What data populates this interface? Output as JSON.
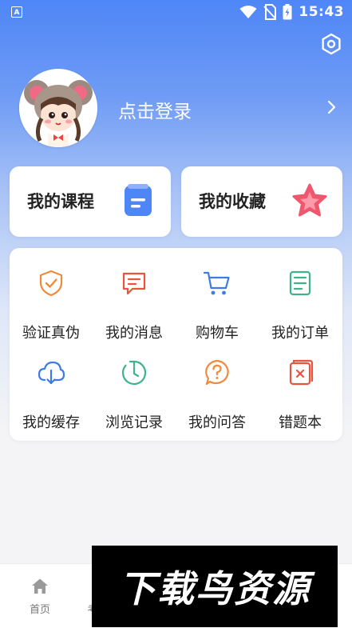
{
  "status_bar": {
    "time": "15:43",
    "app_icon_letter": "A"
  },
  "profile": {
    "login_label": "点击登录"
  },
  "cards": {
    "courses": {
      "label": "我的课程",
      "icon": "document-icon"
    },
    "favorites": {
      "label": "我的收藏",
      "icon": "star-icon"
    }
  },
  "grid": {
    "items": [
      {
        "label": "验证真伪",
        "icon": "shield-check-icon"
      },
      {
        "label": "我的消息",
        "icon": "message-icon"
      },
      {
        "label": "购物车",
        "icon": "cart-icon"
      },
      {
        "label": "我的订单",
        "icon": "order-icon"
      },
      {
        "label": "我的缓存",
        "icon": "cloud-download-icon"
      },
      {
        "label": "浏览记录",
        "icon": "history-icon"
      },
      {
        "label": "我的问答",
        "icon": "question-icon"
      },
      {
        "label": "错题本",
        "icon": "error-book-icon"
      }
    ]
  },
  "tabbar": {
    "home_label": "首页",
    "second_label": "考"
  },
  "watermark": {
    "text": "下载鸟资源"
  },
  "colors": {
    "primary": "#4f86f7",
    "orange": "#f08a3c",
    "red": "#e8553f",
    "blue": "#3d7be8",
    "green": "#3db38a"
  }
}
